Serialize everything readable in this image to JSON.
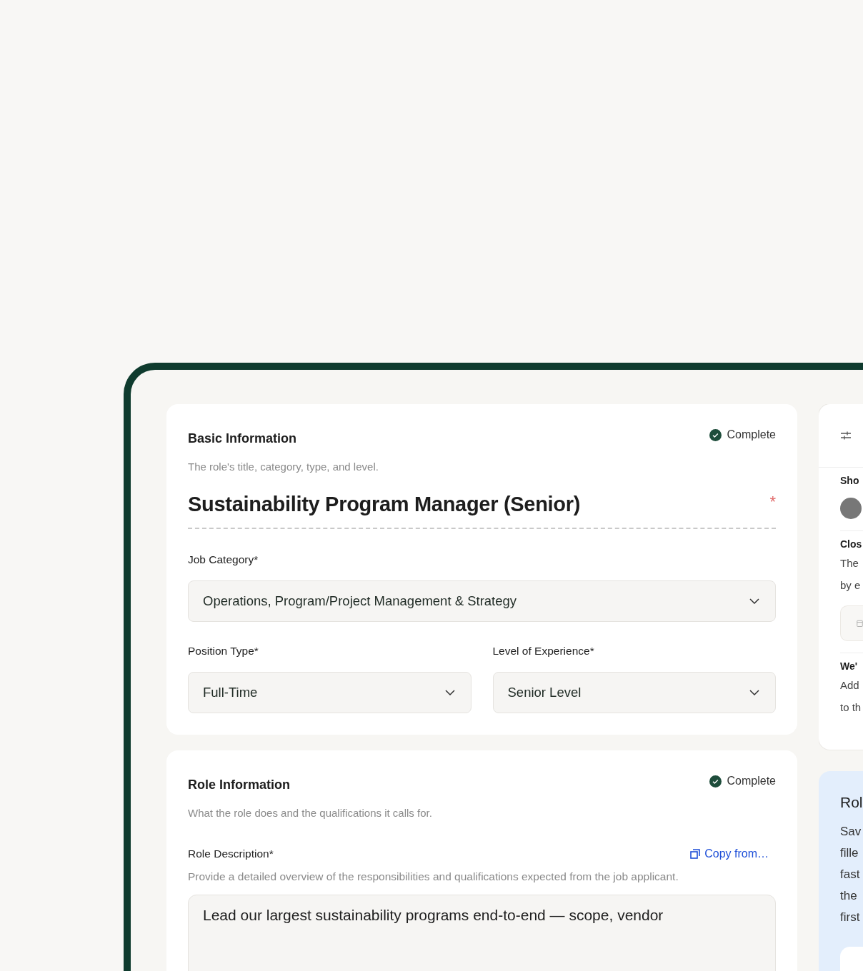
{
  "basic_information": {
    "title": "Basic Information",
    "status": {
      "label": "Complete",
      "complete": true
    },
    "description": "The role's title, category, type, and level.",
    "job_title": "Sustainability Program Manager (Senior)",
    "required_mark": "*",
    "field_rows": [
      [
        {
          "label": "Job Category*",
          "value": "Operations, Program/Project Management & Strategy"
        }
      ],
      [
        {
          "label": "Position Type*",
          "value": "Full-Time"
        },
        {
          "label": "Level of Experience*",
          "value": "Senior Level"
        }
      ]
    ]
  },
  "role_information": {
    "title": "Role Information",
    "status": {
      "label": "Complete",
      "complete": true
    },
    "description": "What the role does and the qualifications it calls for.",
    "field_label": "Role Description*",
    "copy_link": "Copy from…",
    "helper": "Provide a detailed overview of the responsibilities and qualifications expected from the job applicant.",
    "value": "Lead our largest sustainability programs end-to-end — scope, vendor"
  },
  "side_panel": {
    "sections": [
      {
        "kind": "avatar",
        "heading": "Sho"
      },
      {
        "kind": "date",
        "heading": "Clos",
        "lines": [
          "The",
          "by e"
        ]
      },
      {
        "kind": "text",
        "heading": "We'",
        "lines": [
          "Add",
          "to th"
        ]
      }
    ]
  },
  "tip_card": {
    "title": "Rol",
    "lines": [
      "Sav",
      "fille",
      "fast",
      "the",
      "first"
    ]
  }
}
